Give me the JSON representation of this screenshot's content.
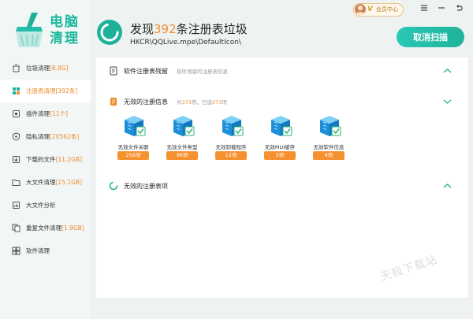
{
  "app": {
    "logo_text": "电脑清理"
  },
  "topbar": {
    "vip_badge": "V",
    "member_label": "会员中心"
  },
  "sidebar": {
    "items": [
      {
        "label": "垃圾清理",
        "count": "[8.8G]",
        "icon": "trash-icon"
      },
      {
        "label": "注册表清理",
        "count": "[392条]",
        "icon": "registry-icon",
        "active": true
      },
      {
        "label": "插件清理",
        "count": "[11个]",
        "icon": "plugin-icon"
      },
      {
        "label": "隐私清理",
        "count": "[20562条]",
        "icon": "privacy-icon"
      },
      {
        "label": "下载的文件",
        "count": "[11.2GB]",
        "icon": "download-icon"
      },
      {
        "label": "大文件清理",
        "count": "[15.1GB]",
        "icon": "folder-icon"
      },
      {
        "label": "大文件分析",
        "count": "",
        "icon": "analysis-icon"
      },
      {
        "label": "重复文件清理",
        "count": "[1.9GB]",
        "icon": "duplicate-icon"
      },
      {
        "label": "软件清理",
        "count": "",
        "icon": "software-icon"
      }
    ]
  },
  "header": {
    "title_prefix": "发现",
    "title_count": "392",
    "title_suffix": "条注册表垃圾",
    "path": "HKCR\\QQLive.mpe\\DefaultIcon\\",
    "cancel_button": "取消扫描"
  },
  "panel": {
    "section1": {
      "title": "软件注册表残留",
      "subtitle": "软件残留的注册表信息"
    },
    "section2": {
      "title": "无效的注册信息",
      "subtitle_prefix": "共",
      "subtitle_count1": "373",
      "subtitle_mid": "项，已选",
      "subtitle_count2": "373",
      "subtitle_suffix": "项",
      "cards": [
        {
          "label": "无效文件关联",
          "badge": "256项"
        },
        {
          "label": "无效文件类型",
          "badge": "96项"
        },
        {
          "label": "无效卸载程序",
          "badge": "12项"
        },
        {
          "label": "无效MUI缓存",
          "badge": "5项"
        },
        {
          "label": "无效软件信息",
          "badge": "4项"
        }
      ]
    },
    "section3": {
      "title": "无效的注册表项"
    }
  },
  "watermark": "天极下载站",
  "colors": {
    "accent": "#1fb29a",
    "highlight": "#f08c2a",
    "badge": "#f5922f"
  }
}
